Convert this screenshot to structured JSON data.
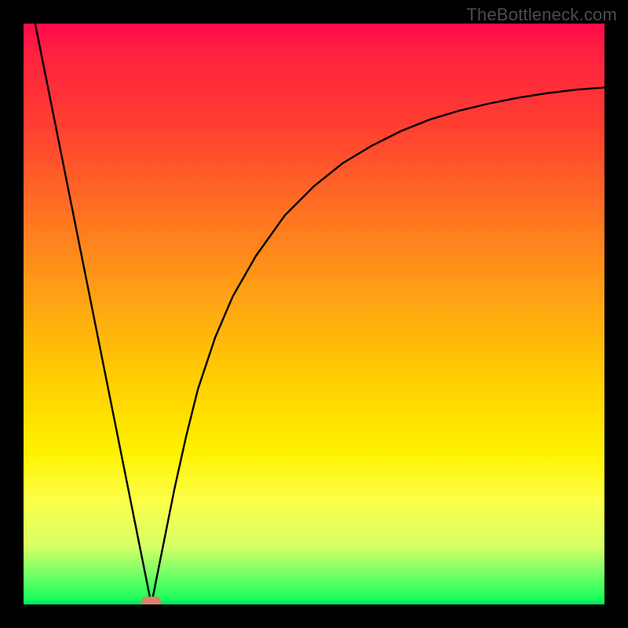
{
  "attribution": "TheBottleneck.com",
  "chart_data": {
    "type": "line",
    "title": "",
    "xlabel": "",
    "ylabel": "",
    "xlim": [
      0,
      100
    ],
    "ylim": [
      0,
      100
    ],
    "axes_visible": false,
    "grid": false,
    "legend": false,
    "background": "vertical-gradient red→orange→yellow→green",
    "marker": {
      "x": 22,
      "y": 0,
      "color": "#d9816b",
      "shape": "rounded-rect"
    },
    "series": [
      {
        "name": "curve",
        "color": "#000000",
        "x": [
          2,
          4,
          6,
          8,
          10,
          12,
          14,
          16,
          18,
          20,
          21,
          22,
          23,
          24,
          26,
          28,
          30,
          33,
          36,
          40,
          45,
          50,
          55,
          60,
          65,
          70,
          75,
          80,
          85,
          90,
          95,
          100
        ],
        "y": [
          100,
          90,
          80,
          70,
          60,
          50,
          40,
          30,
          20,
          10,
          5,
          0,
          5,
          10,
          20,
          29,
          37,
          46,
          53,
          60,
          67,
          72,
          76,
          79,
          81.5,
          83.5,
          85,
          86.2,
          87.2,
          88,
          88.6,
          89
        ]
      }
    ]
  }
}
